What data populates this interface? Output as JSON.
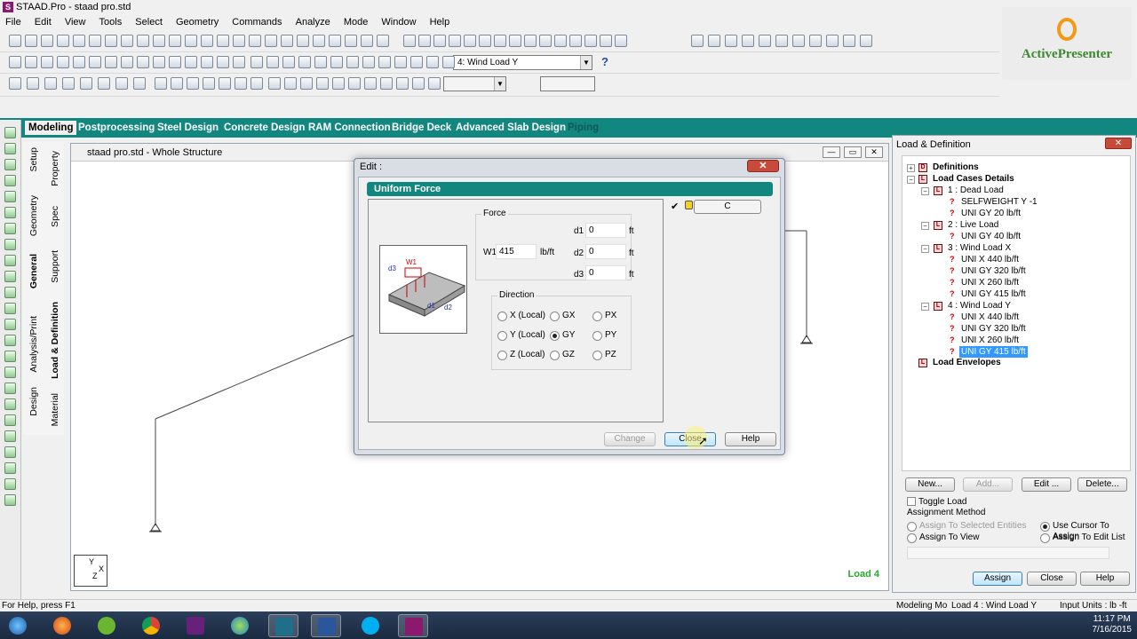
{
  "app": {
    "title": "STAAD.Pro - staad pro.std"
  },
  "menu": [
    "File",
    "Edit",
    "View",
    "Tools",
    "Select",
    "Geometry",
    "Commands",
    "Analyze",
    "Mode",
    "Window",
    "Help"
  ],
  "toolbar": {
    "load_select": "4: Wind Load Y"
  },
  "watermark": {
    "text": "ActivePresenter"
  },
  "tabs": [
    "Modeling",
    "Postprocessing",
    "Steel Design",
    "Concrete Design",
    "RAM Connection",
    "Bridge Deck",
    "Advanced Slab Design",
    "Piping"
  ],
  "vertical_tabs": {
    "outer": [
      "Setup",
      "Geometry",
      "General",
      "Analysis/Print",
      "Design"
    ],
    "inner": [
      "Property",
      "Spec",
      "Support",
      "Load & Definition",
      "Material"
    ]
  },
  "structure_window": {
    "title": "staad pro.std - Whole Structure",
    "load_label": "Load 4",
    "axis_y": "Y",
    "axis_z": "Z",
    "axis_x": "X"
  },
  "edit_dialog": {
    "title": "Edit :",
    "header": "Uniform Force",
    "column_label": "C",
    "force_group": "Force",
    "w1_label": "W1",
    "w1_value": "415",
    "w1_unit": "lb/ft",
    "d1_label": "d1",
    "d1_value": "0",
    "d1_unit": "ft",
    "d2_label": "d2",
    "d2_value": "0",
    "d2_unit": "ft",
    "d3_label": "d3",
    "d3_value": "0",
    "d3_unit": "ft",
    "direction_group": "Direction",
    "directions": [
      "X (Local)",
      "Y (Local)",
      "Z (Local)",
      "GX",
      "GY",
      "GZ",
      "PX",
      "PY",
      "PZ"
    ],
    "selected_direction": "GY",
    "buttons": {
      "change": "Change",
      "close": "Close",
      "help": "Help"
    }
  },
  "load_panel": {
    "title": "Load & Definition",
    "tree": {
      "definitions": "Definitions",
      "load_cases_details": "Load Cases Details",
      "case1": "1 : Dead Load",
      "case1_items": [
        "SELFWEIGHT Y -1",
        "UNI GY 20 lb/ft"
      ],
      "case2": "2 : Live Load",
      "case2_items": [
        "UNI GY 40 lb/ft"
      ],
      "case3": "3 : Wind Load X",
      "case3_items": [
        "UNI X 440 lb/ft",
        "UNI GY 320 lb/ft",
        "UNI X 260 lb/ft",
        "UNI GY 415 lb/ft"
      ],
      "case4": "4 : Wind Load Y",
      "case4_items": [
        "UNI X 440 lb/ft",
        "UNI GY 320 lb/ft",
        "UNI X 260 lb/ft",
        "UNI GY 415 lb/ft"
      ],
      "load_envelopes": "Load Envelopes"
    },
    "buttons": {
      "new": "New...",
      "add": "Add...",
      "edit": "Edit ...",
      "delete": "Delete..."
    },
    "toggle_load": "Toggle Load",
    "assignment_method": "Assignment Method",
    "assign_options": [
      "Assign To Selected Entities",
      "Use Cursor To Assign",
      "Assign To View",
      "Assign To Edit List"
    ],
    "bottom_buttons": {
      "assign": "Assign",
      "close": "Close",
      "help": "Help"
    }
  },
  "status": {
    "help": "For Help, press F1",
    "mode": "Modeling Mo",
    "load": "Load 4 : Wind Load Y",
    "units": "Input Units : lb -ft"
  },
  "taskbar": {
    "time": "11:17 PM",
    "date": "7/16/2015"
  }
}
